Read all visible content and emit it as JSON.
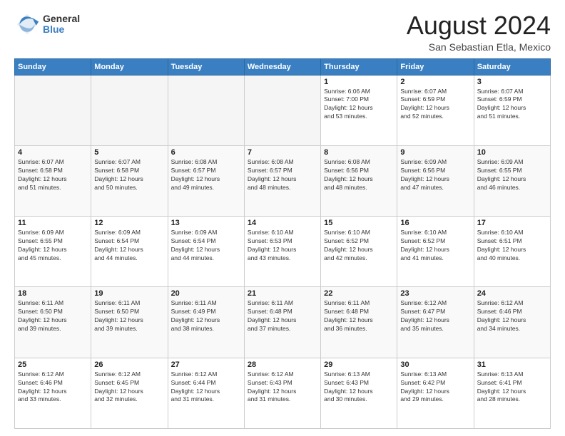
{
  "header": {
    "logo_general": "General",
    "logo_blue": "Blue",
    "title": "August 2024",
    "location": "San Sebastian Etla, Mexico"
  },
  "days_of_week": [
    "Sunday",
    "Monday",
    "Tuesday",
    "Wednesday",
    "Thursday",
    "Friday",
    "Saturday"
  ],
  "weeks": [
    [
      {
        "day": "",
        "info": ""
      },
      {
        "day": "",
        "info": ""
      },
      {
        "day": "",
        "info": ""
      },
      {
        "day": "",
        "info": ""
      },
      {
        "day": "1",
        "info": "Sunrise: 6:06 AM\nSunset: 7:00 PM\nDaylight: 12 hours\nand 53 minutes."
      },
      {
        "day": "2",
        "info": "Sunrise: 6:07 AM\nSunset: 6:59 PM\nDaylight: 12 hours\nand 52 minutes."
      },
      {
        "day": "3",
        "info": "Sunrise: 6:07 AM\nSunset: 6:59 PM\nDaylight: 12 hours\nand 51 minutes."
      }
    ],
    [
      {
        "day": "4",
        "info": "Sunrise: 6:07 AM\nSunset: 6:58 PM\nDaylight: 12 hours\nand 51 minutes."
      },
      {
        "day": "5",
        "info": "Sunrise: 6:07 AM\nSunset: 6:58 PM\nDaylight: 12 hours\nand 50 minutes."
      },
      {
        "day": "6",
        "info": "Sunrise: 6:08 AM\nSunset: 6:57 PM\nDaylight: 12 hours\nand 49 minutes."
      },
      {
        "day": "7",
        "info": "Sunrise: 6:08 AM\nSunset: 6:57 PM\nDaylight: 12 hours\nand 48 minutes."
      },
      {
        "day": "8",
        "info": "Sunrise: 6:08 AM\nSunset: 6:56 PM\nDaylight: 12 hours\nand 48 minutes."
      },
      {
        "day": "9",
        "info": "Sunrise: 6:09 AM\nSunset: 6:56 PM\nDaylight: 12 hours\nand 47 minutes."
      },
      {
        "day": "10",
        "info": "Sunrise: 6:09 AM\nSunset: 6:55 PM\nDaylight: 12 hours\nand 46 minutes."
      }
    ],
    [
      {
        "day": "11",
        "info": "Sunrise: 6:09 AM\nSunset: 6:55 PM\nDaylight: 12 hours\nand 45 minutes."
      },
      {
        "day": "12",
        "info": "Sunrise: 6:09 AM\nSunset: 6:54 PM\nDaylight: 12 hours\nand 44 minutes."
      },
      {
        "day": "13",
        "info": "Sunrise: 6:09 AM\nSunset: 6:54 PM\nDaylight: 12 hours\nand 44 minutes."
      },
      {
        "day": "14",
        "info": "Sunrise: 6:10 AM\nSunset: 6:53 PM\nDaylight: 12 hours\nand 43 minutes."
      },
      {
        "day": "15",
        "info": "Sunrise: 6:10 AM\nSunset: 6:52 PM\nDaylight: 12 hours\nand 42 minutes."
      },
      {
        "day": "16",
        "info": "Sunrise: 6:10 AM\nSunset: 6:52 PM\nDaylight: 12 hours\nand 41 minutes."
      },
      {
        "day": "17",
        "info": "Sunrise: 6:10 AM\nSunset: 6:51 PM\nDaylight: 12 hours\nand 40 minutes."
      }
    ],
    [
      {
        "day": "18",
        "info": "Sunrise: 6:11 AM\nSunset: 6:50 PM\nDaylight: 12 hours\nand 39 minutes."
      },
      {
        "day": "19",
        "info": "Sunrise: 6:11 AM\nSunset: 6:50 PM\nDaylight: 12 hours\nand 39 minutes."
      },
      {
        "day": "20",
        "info": "Sunrise: 6:11 AM\nSunset: 6:49 PM\nDaylight: 12 hours\nand 38 minutes."
      },
      {
        "day": "21",
        "info": "Sunrise: 6:11 AM\nSunset: 6:48 PM\nDaylight: 12 hours\nand 37 minutes."
      },
      {
        "day": "22",
        "info": "Sunrise: 6:11 AM\nSunset: 6:48 PM\nDaylight: 12 hours\nand 36 minutes."
      },
      {
        "day": "23",
        "info": "Sunrise: 6:12 AM\nSunset: 6:47 PM\nDaylight: 12 hours\nand 35 minutes."
      },
      {
        "day": "24",
        "info": "Sunrise: 6:12 AM\nSunset: 6:46 PM\nDaylight: 12 hours\nand 34 minutes."
      }
    ],
    [
      {
        "day": "25",
        "info": "Sunrise: 6:12 AM\nSunset: 6:46 PM\nDaylight: 12 hours\nand 33 minutes."
      },
      {
        "day": "26",
        "info": "Sunrise: 6:12 AM\nSunset: 6:45 PM\nDaylight: 12 hours\nand 32 minutes."
      },
      {
        "day": "27",
        "info": "Sunrise: 6:12 AM\nSunset: 6:44 PM\nDaylight: 12 hours\nand 31 minutes."
      },
      {
        "day": "28",
        "info": "Sunrise: 6:12 AM\nSunset: 6:43 PM\nDaylight: 12 hours\nand 31 minutes."
      },
      {
        "day": "29",
        "info": "Sunrise: 6:13 AM\nSunset: 6:43 PM\nDaylight: 12 hours\nand 30 minutes."
      },
      {
        "day": "30",
        "info": "Sunrise: 6:13 AM\nSunset: 6:42 PM\nDaylight: 12 hours\nand 29 minutes."
      },
      {
        "day": "31",
        "info": "Sunrise: 6:13 AM\nSunset: 6:41 PM\nDaylight: 12 hours\nand 28 minutes."
      }
    ]
  ]
}
